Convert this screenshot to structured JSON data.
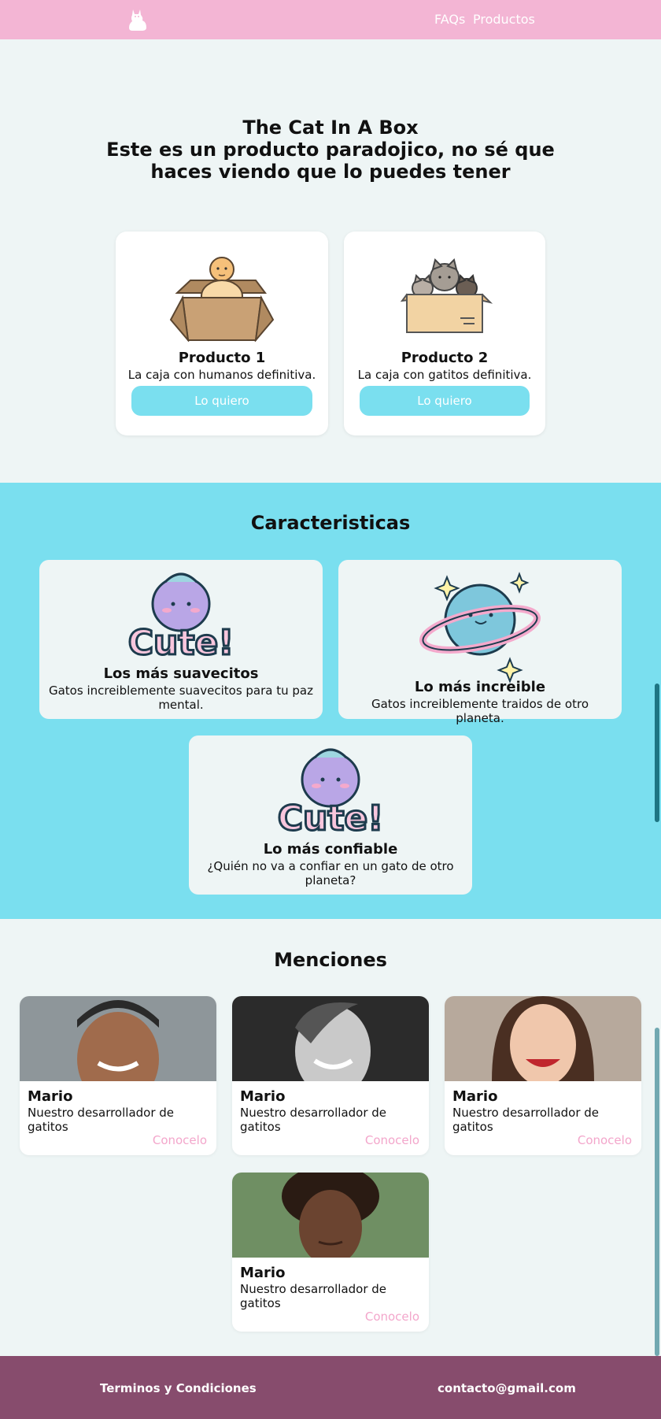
{
  "header": {
    "logo_icon": "cat-silhouette-icon",
    "nav": [
      "FAQs",
      "Productos"
    ]
  },
  "hero": {
    "title_line1": "The Cat In A Box",
    "title_line2": "Este es un producto paradojico, no sé que haces viendo que lo puedes tener"
  },
  "products": [
    {
      "name": "Producto 1",
      "desc": "La caja con humanos definitiva.",
      "button": "Lo quiero",
      "image_icon": "baby-in-box-illustration"
    },
    {
      "name": "Producto 2",
      "desc": "La caja con gatitos definitiva.",
      "button": "Lo quiero",
      "image_icon": "cats-in-box-illustration"
    }
  ],
  "features": {
    "title": "Caracteristicas",
    "items": [
      {
        "name": "Los más suavecitos",
        "desc": "Gatos increiblemente suavecitos para tu paz mental.",
        "image_icon": "cute-sticker-illustration"
      },
      {
        "name": "Lo más increible",
        "desc": "Gatos increiblemente traidos de otro planeta.",
        "image_icon": "planet-illustration"
      },
      {
        "name": "Lo más confiable",
        "desc": "¿Quién no va a confiar en un gato de otro planeta?",
        "image_icon": "cute-sticker-illustration"
      }
    ]
  },
  "mentions": {
    "title": "Menciones",
    "people": [
      {
        "name": "Mario",
        "role": "Nuestro desarrollador de gatitos",
        "link": "Conocelo"
      },
      {
        "name": "Mario",
        "role": "Nuestro desarrollador de gatitos",
        "link": "Conocelo"
      },
      {
        "name": "Mario",
        "role": "Nuestro desarrollador de gatitos",
        "link": "Conocelo"
      },
      {
        "name": "Mario",
        "role": "Nuestro desarrollador de gatitos",
        "link": "Conocelo"
      }
    ]
  },
  "footer": {
    "terms": "Terminos y Condiciones",
    "email": "contacto@gmail.com"
  },
  "colors": {
    "header_pink": "#f3b5d4",
    "cyan": "#7adfef",
    "footer_plum": "#874c6d",
    "link_pink": "#f3a6cb"
  }
}
